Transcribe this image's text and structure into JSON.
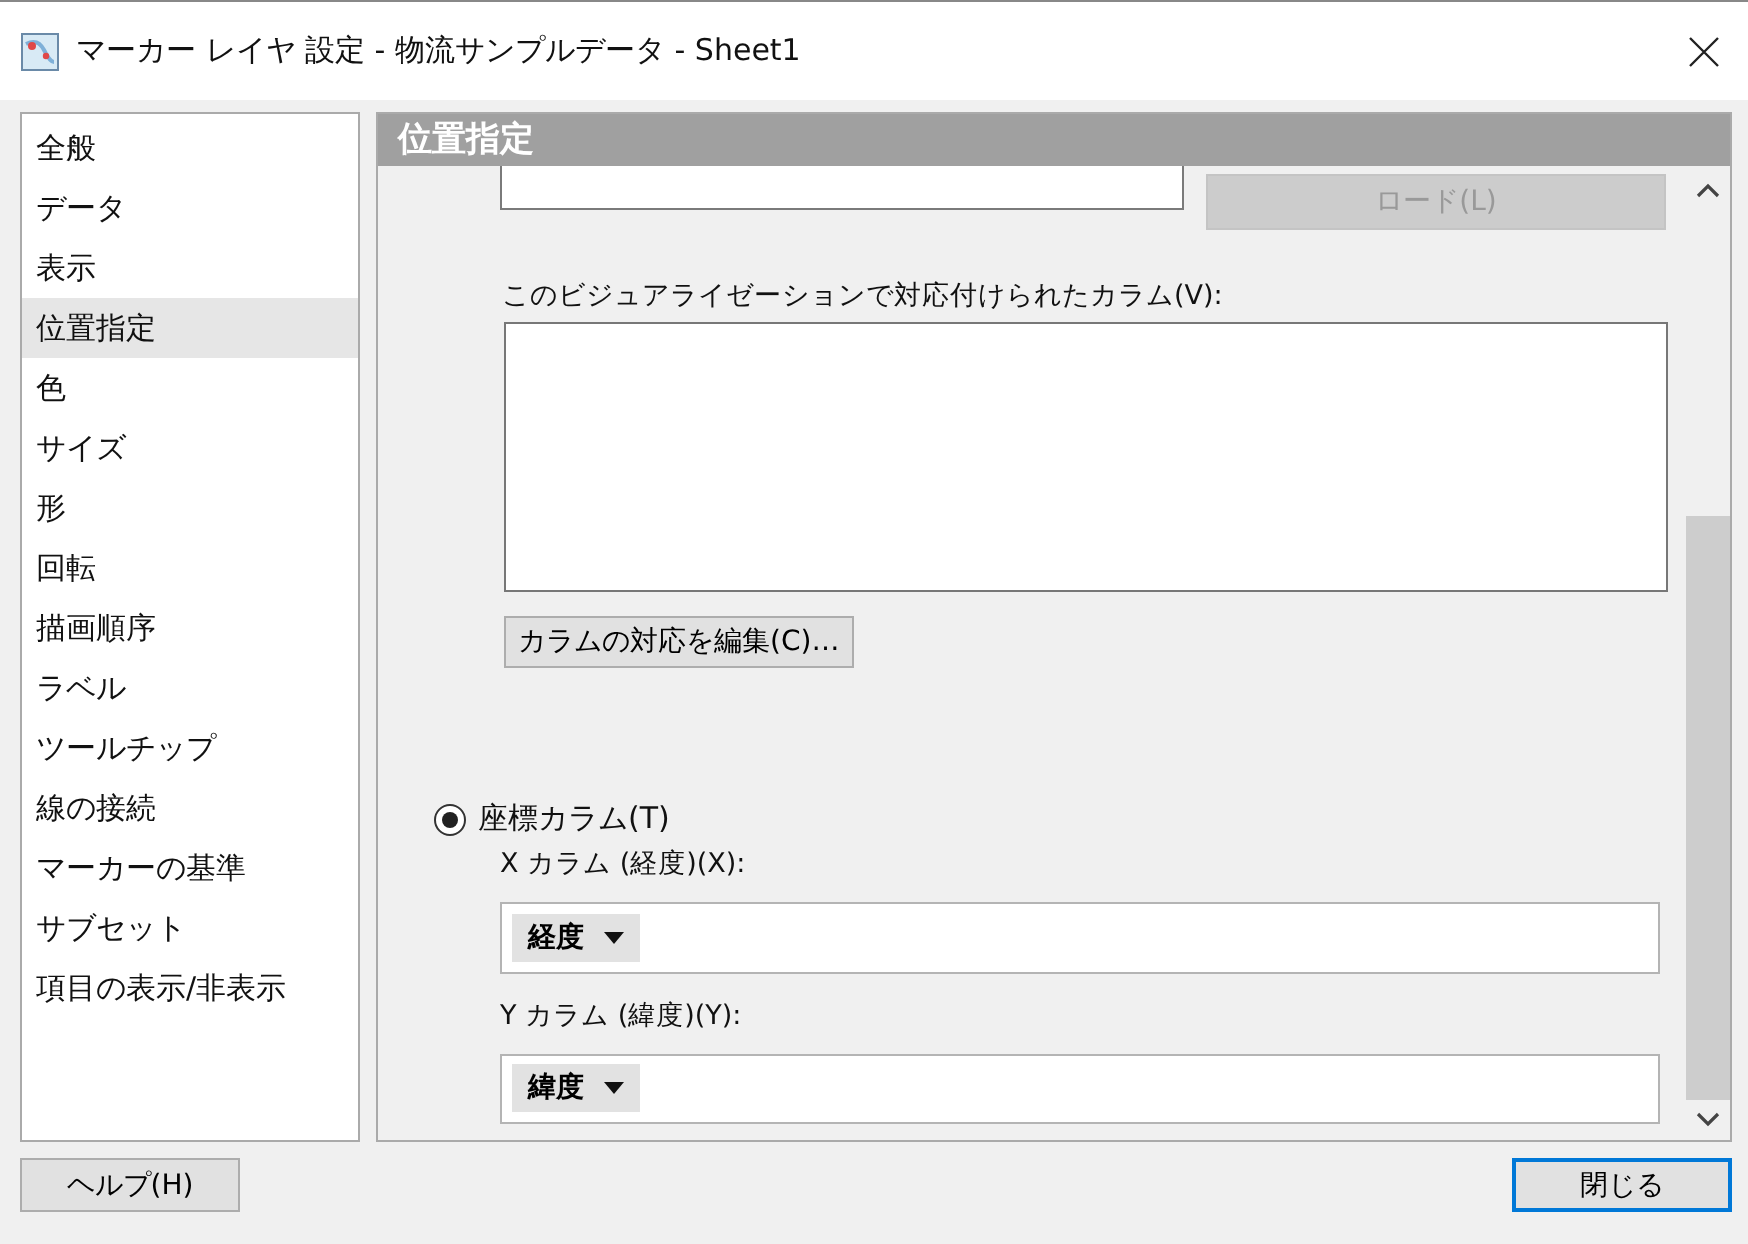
{
  "window": {
    "title": "マーカー レイヤ 設定 - 物流サンプルデータ - Sheet1"
  },
  "sidebar": {
    "items": [
      {
        "label": "全般",
        "selected": false
      },
      {
        "label": "データ",
        "selected": false
      },
      {
        "label": "表示",
        "selected": false
      },
      {
        "label": "位置指定",
        "selected": true
      },
      {
        "label": "色",
        "selected": false
      },
      {
        "label": "サイズ",
        "selected": false
      },
      {
        "label": "形",
        "selected": false
      },
      {
        "label": "回転",
        "selected": false
      },
      {
        "label": "描画順序",
        "selected": false
      },
      {
        "label": "ラベル",
        "selected": false
      },
      {
        "label": "ツールチップ",
        "selected": false
      },
      {
        "label": "線の接続",
        "selected": false
      },
      {
        "label": "マーカーの基準",
        "selected": false
      },
      {
        "label": "サブセット",
        "selected": false
      },
      {
        "label": "項目の表示/非表示",
        "selected": false
      }
    ]
  },
  "panel": {
    "title": "位置指定",
    "load_button": {
      "label": "ロード(L)",
      "disabled": true
    },
    "mapped_columns_label": "このビジュアライゼーションで対応付けられたカラム(V):",
    "edit_button": "カラムの対応を編集(C)…",
    "coordinate_radio": {
      "label": "座標カラム(T)",
      "selected": true
    },
    "x_label": "X カラム (経度)(X):",
    "x_value": "経度",
    "y_label": "Y カラム (緯度)(Y):",
    "y_value": "緯度"
  },
  "buttons": {
    "help": "ヘルプ(H)",
    "close": "閉じる"
  }
}
